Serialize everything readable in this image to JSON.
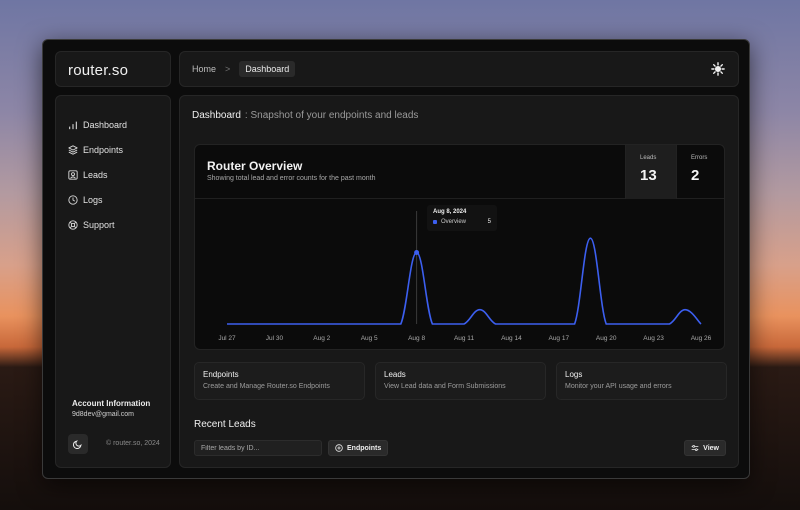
{
  "app": {
    "logo": "router.so"
  },
  "breadcrumb": {
    "home": "Home",
    "separator": ">",
    "current": "Dashboard"
  },
  "sidebar": {
    "items": [
      {
        "label": "Dashboard",
        "icon": "bar-chart-icon"
      },
      {
        "label": "Endpoints",
        "icon": "layers-icon"
      },
      {
        "label": "Leads",
        "icon": "contact-icon"
      },
      {
        "label": "Logs",
        "icon": "history-icon"
      },
      {
        "label": "Support",
        "icon": "lifebuoy-icon"
      }
    ],
    "account_title": "Account Information",
    "account_email": "9d8dev@gmail.com",
    "copyright": "© router.so, 2024"
  },
  "page": {
    "title": "Dashboard",
    "subtitle": ": Snapshot of your endpoints and leads"
  },
  "overview": {
    "title": "Router Overview",
    "subtitle": "Showing total lead and error counts for the past month",
    "leads_label": "Leads",
    "leads_value": "13",
    "errors_label": "Errors",
    "errors_value": "2"
  },
  "tooltip": {
    "date": "Aug 8, 2024",
    "series": "Overview",
    "value": "5"
  },
  "chart_data": {
    "type": "area",
    "series": [
      {
        "name": "Overview",
        "color": "#3c5ff0"
      }
    ],
    "x": [
      "Jul 27",
      "Jul 28",
      "Jul 29",
      "Jul 30",
      "Jul 31",
      "Aug 1",
      "Aug 2",
      "Aug 3",
      "Aug 4",
      "Aug 5",
      "Aug 6",
      "Aug 7",
      "Aug 8",
      "Aug 9",
      "Aug 10",
      "Aug 11",
      "Aug 12",
      "Aug 13",
      "Aug 14",
      "Aug 15",
      "Aug 16",
      "Aug 17",
      "Aug 18",
      "Aug 19",
      "Aug 20",
      "Aug 21",
      "Aug 22",
      "Aug 23",
      "Aug 24",
      "Aug 25",
      "Aug 26"
    ],
    "values": [
      0,
      0,
      0,
      0,
      0,
      0,
      0,
      0,
      0,
      0,
      0,
      0,
      5,
      0,
      0,
      0,
      1,
      0,
      0,
      0,
      0,
      0,
      0,
      6,
      0,
      0,
      0,
      0,
      0,
      1,
      0
    ],
    "tick_labels": [
      "Jul 27",
      "Jul 30",
      "Aug 2",
      "Aug 5",
      "Aug 8",
      "Aug 11",
      "Aug 14",
      "Aug 17",
      "Aug 20",
      "Aug 23",
      "Aug 26"
    ],
    "ylim": [
      0,
      6.5
    ],
    "grid": false
  },
  "cards": [
    {
      "title": "Endpoints",
      "desc": "Create and Manage Router.so Endpoints"
    },
    {
      "title": "Leads",
      "desc": "View Lead data and Form Submissions"
    },
    {
      "title": "Logs",
      "desc": "Monitor your API usage and errors"
    }
  ],
  "recent": {
    "title": "Recent Leads",
    "filter_placeholder": "Filter leads by ID...",
    "endpoints_button": "Endpoints",
    "view_button": "View"
  }
}
